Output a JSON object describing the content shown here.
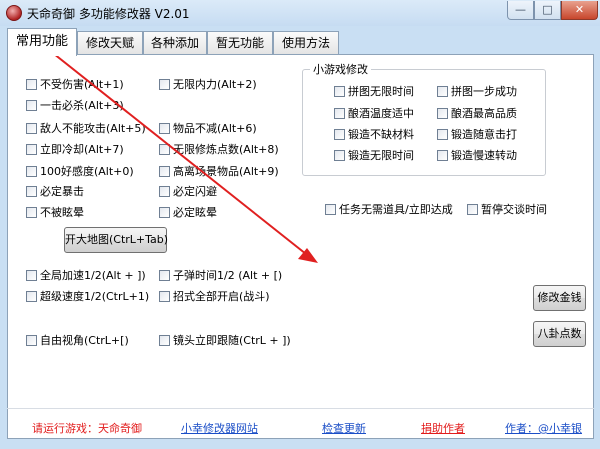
{
  "window": {
    "title": "天命奇御 多功能修改器  V2.01",
    "min_glyph": "—",
    "max_glyph": "□",
    "close_glyph": "✕"
  },
  "tabs": [
    {
      "label": "常用功能",
      "active": true
    },
    {
      "label": "修改天赋",
      "active": false
    },
    {
      "label": "各种添加",
      "active": false
    },
    {
      "label": "暂无功能",
      "active": false
    },
    {
      "label": "使用方法",
      "active": false
    }
  ],
  "left_column": [
    "不受伤害(Alt+1)",
    "一击必杀(Alt+3)",
    "敌人不能攻击(Alt+5)",
    "立即冷却(Alt+7)",
    "100好感度(Alt+0)",
    "必定暴击",
    "不被眩晕"
  ],
  "right_column": [
    "无限内力(Alt+2)",
    "物品不减(Alt+6)",
    "无限修炼点数(Alt+8)",
    "高离场景物品(Alt+9)",
    "必定闪避",
    "必定眩晕"
  ],
  "minigame": {
    "title": "小游戏修改",
    "left": [
      "拼图无限时间",
      "酿酒温度适中",
      "锻造不缺材料",
      "锻造无限时间"
    ],
    "right": [
      "拼图一步成功",
      "酿酒最高品质",
      "锻造随意击打",
      "锻造慢速转动"
    ]
  },
  "extra_options": [
    "任务无需道具/立即达成",
    "暂停交谈时间"
  ],
  "map_button": "开大地图(CtrL+Tab)",
  "speed": {
    "global": "全局加速1/2(Alt + ])",
    "super": "超级速度1/2(CtrL+1)",
    "bullet": "子弹时间1/2 (Alt + [)",
    "skills": "招式全部开启(战斗)"
  },
  "camera": {
    "free": "自由视角(CtrL+[)",
    "follow": "镜头立即跟随(CtrL + ])"
  },
  "buttons": {
    "money": "修改金钱",
    "bagua": "八卦点数"
  },
  "footer": {
    "run_game": "请运行游戏：天命奇御",
    "site": "小幸修改器网站",
    "update": "检查更新",
    "donate": "捐助作者",
    "author": "作者：@小幸银"
  },
  "colors": {
    "arrow": "#e02020",
    "footer_red": "#e21c1c",
    "footer_blue": "#1b4ec7"
  }
}
